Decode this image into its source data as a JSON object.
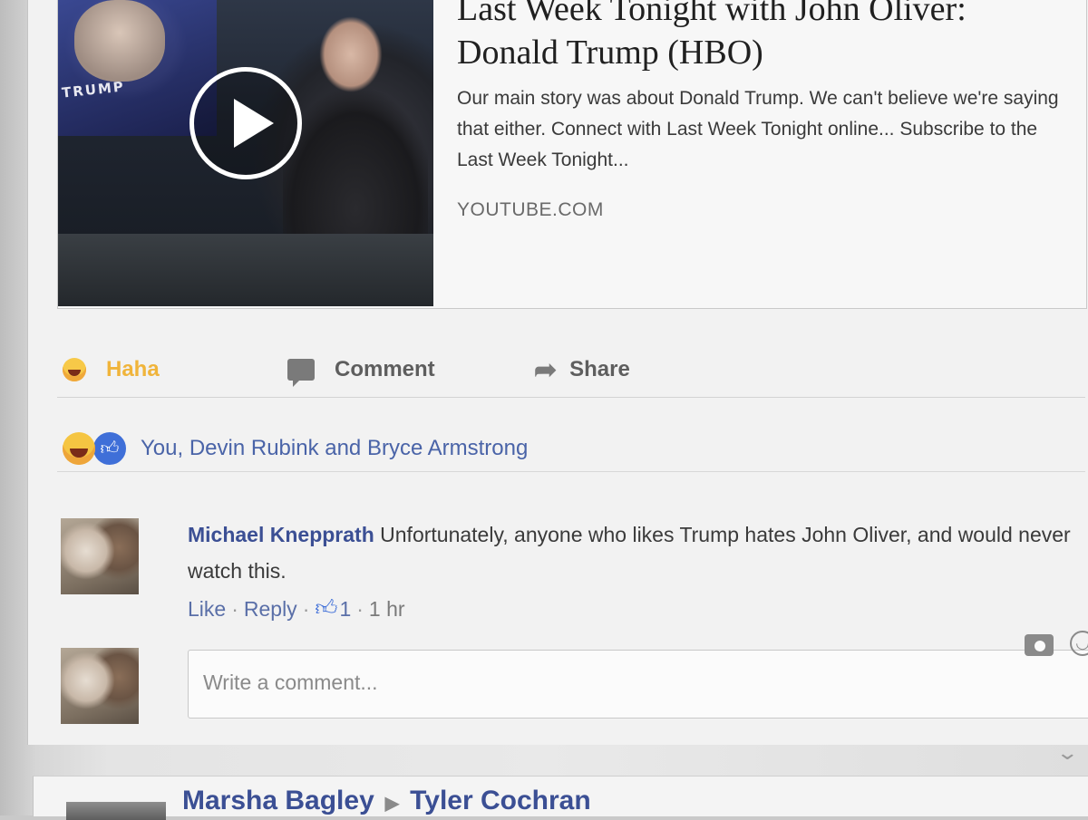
{
  "link_preview": {
    "thumbnail_text": "TRUMP",
    "title": "Last Week Tonight with John Oliver: Donald Trump (HBO)",
    "description": "Our main story was about Donald Trump. We can't believe we're saying that either. Connect with Last Week Tonight online... Subscribe to the Last Week Tonight...",
    "domain": "YOUTUBE.COM"
  },
  "actions": {
    "haha_label": "Haha",
    "comment_label": "Comment",
    "share_label": "Share"
  },
  "reactions": {
    "summary": "You, Devin Rubink and Bryce Armstrong"
  },
  "comment": {
    "author": "Michael Knepprath",
    "text": "Unfortunately, anyone who likes Trump hates John Oliver, and would never watch this.",
    "like_label": "Like",
    "reply_label": "Reply",
    "like_count": "1",
    "time": "1 hr"
  },
  "composer": {
    "placeholder": "Write a comment..."
  },
  "next_post": {
    "author": "Marsha Bagley",
    "target": "Tyler Cochran"
  },
  "colors": {
    "link_blue": "#3b4f94",
    "haha_yellow": "#f0b43a",
    "like_blue": "#3f6fd8"
  }
}
